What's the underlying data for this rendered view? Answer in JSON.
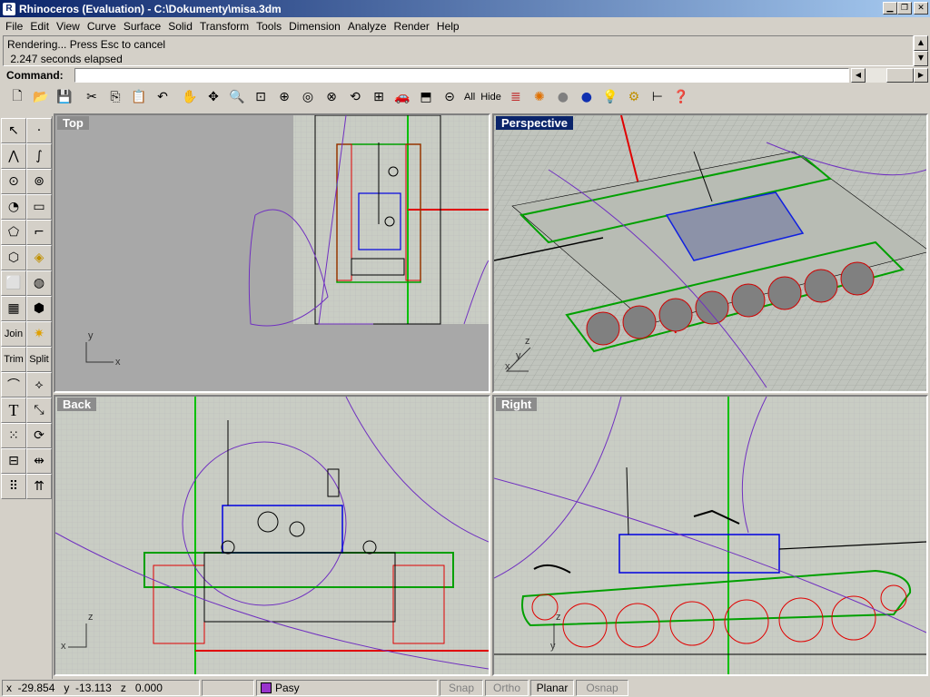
{
  "window": {
    "title": "Rhinoceros (Evaluation) - C:\\Dokumenty\\misa.3dm"
  },
  "menu": [
    "File",
    "Edit",
    "View",
    "Curve",
    "Surface",
    "Solid",
    "Transform",
    "Tools",
    "Dimension",
    "Analyze",
    "Render",
    "Help"
  ],
  "history": {
    "line1": "Rendering... Press Esc to cancel",
    "line2": " 2.247 seconds elapsed"
  },
  "command": {
    "label": "Command:",
    "value": ""
  },
  "toolbar": {
    "all_label": "All",
    "hide_label": "Hide"
  },
  "lefttools": {
    "join_label": "Join",
    "trim_label": "Trim",
    "split_label": "Split",
    "text_label": "T"
  },
  "viewports": {
    "top": "Top",
    "perspective": "Perspective",
    "back": "Back",
    "right": "Right"
  },
  "axes": {
    "x": "x",
    "y": "y",
    "z": "z"
  },
  "status": {
    "x": "x  -29.854",
    "y": "y  -13.113",
    "z": "z   0.000",
    "layer": "Pasy",
    "layer_color": "#9933cc",
    "snap": "Snap",
    "ortho": "Ortho",
    "planar": "Planar",
    "osnap": "Osnap"
  }
}
